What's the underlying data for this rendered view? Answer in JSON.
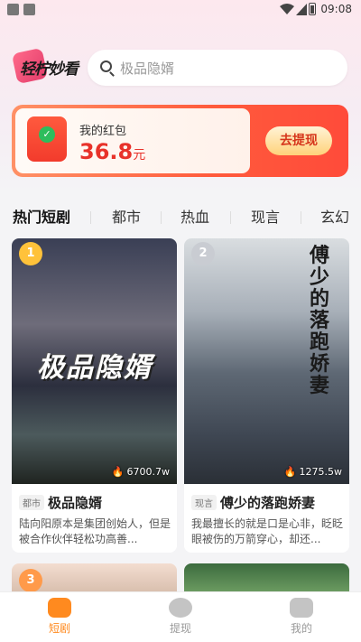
{
  "status": {
    "time": "09:08"
  },
  "header": {
    "logo_text": "轻柠妙看",
    "search_placeholder": "极品隐婿"
  },
  "wallet": {
    "label": "我的红包",
    "amount": "36.8",
    "unit": "元",
    "button": "去提现"
  },
  "tabs": [
    {
      "label": "热门短剧",
      "active": true
    },
    {
      "label": "都市"
    },
    {
      "label": "热血"
    },
    {
      "label": "现言"
    },
    {
      "label": "玄幻"
    }
  ],
  "cards": [
    {
      "rank": "1",
      "poster_title": "极品隐婿",
      "views": "6700.7w",
      "tag": "都市",
      "title": "极品隐婿",
      "desc": "陆向阳原本是集团创始人，但是被合作伙伴轻松功高善..."
    },
    {
      "rank": "2",
      "poster_title": "傅少的落跑娇妻",
      "views": "1275.5w",
      "tag": "现言",
      "title": "傅少的落跑娇妻",
      "desc": "我最擅长的就是口是心非，眨眨眼被伤的万箭穿心，却还..."
    }
  ],
  "next_cards": [
    {
      "rank": "3"
    }
  ],
  "nav": [
    {
      "label": "短剧",
      "icon": "play-icon",
      "active": true,
      "color": "#ff8a1f"
    },
    {
      "label": "提现",
      "icon": "wallet-icon",
      "active": false,
      "color": "#9a9a9a"
    },
    {
      "label": "我的",
      "icon": "profile-icon",
      "active": false,
      "color": "#9a9a9a"
    }
  ]
}
